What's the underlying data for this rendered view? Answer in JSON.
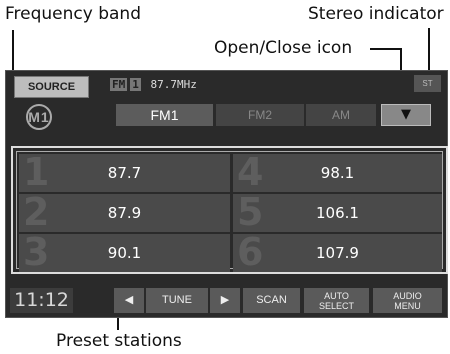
{
  "callouts": {
    "frequency_band": "Frequency band",
    "stereo_indicator": "Stereo indicator",
    "open_close_icon": "Open/Close icon",
    "preset_stations": "Preset stations"
  },
  "header": {
    "source_label": "SOURCE",
    "band_badge": "FM",
    "band_num": "1",
    "frequency": "87.7MHz",
    "stereo": "ST"
  },
  "tabs": {
    "memory": "M1",
    "fm1": "FM1",
    "fm2": "FM2",
    "am": "AM"
  },
  "open_close_symbol": "▼",
  "presets": [
    {
      "num": "1",
      "value": "87.7"
    },
    {
      "num": "2",
      "value": "87.9"
    },
    {
      "num": "3",
      "value": "90.1"
    },
    {
      "num": "4",
      "value": "98.1"
    },
    {
      "num": "5",
      "value": "106.1"
    },
    {
      "num": "6",
      "value": "107.9"
    }
  ],
  "bottom": {
    "time": "11:12",
    "tune_left": "◀",
    "tune_label": "TUNE",
    "tune_right": "▶",
    "scan": "SCAN",
    "auto_select_1": "AUTO",
    "auto_select_2": "SELECT",
    "audio_menu_1": "AUDIO",
    "audio_menu_2": "MENU"
  }
}
